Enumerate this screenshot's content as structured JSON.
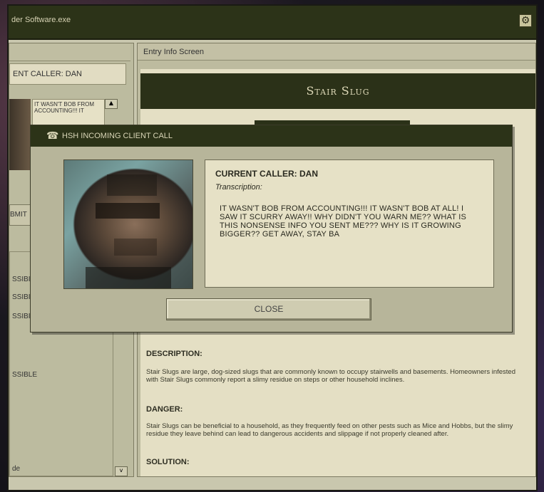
{
  "window": {
    "title": "der Software.exe",
    "icon": "gear-icon"
  },
  "left_panel": {
    "current_caller": "ENT CALLER: DAN",
    "mini_transcript": "IT WASN'T BOB FROM ACCOUNTING!!! IT",
    "submit_label": "BMIT",
    "possible_items": [
      "SSIBI",
      "SSIBI",
      "SSIBI",
      "SSIBLE"
    ],
    "bottom_text": "de",
    "scroll_down": "v"
  },
  "entry": {
    "header": "Entry Info Screen",
    "title": "Stair Slug",
    "sections": [
      {
        "heading": "DESCRIPTION:",
        "text": "Stair Slugs are large, dog-sized slugs that are commonly known to occupy stairwells and basements. Homeowners infested with Stair Slugs commonly report a slimy residue on steps or other household inclines."
      },
      {
        "heading": "DANGER:",
        "text": "Stair Slugs can be beneficial to a household, as they frequently feed on other pests such as Mice and Hobbs, but the slimy residue they leave behind can lead to dangerous accidents and slippage if not properly cleaned after."
      },
      {
        "heading": "SOLUTION:",
        "text": ""
      }
    ]
  },
  "dialog": {
    "title": "HSH INCOMING CLIENT CALL",
    "icon": "phone-icon",
    "caller_label": "CURRENT CALLER: DAN",
    "transcription_label": "Transcription:",
    "transcription": "IT WASN'T BOB FROM ACCOUNTING!!! IT WASN'T BOB AT ALL! I SAW IT SCURRY AWAY!! WHY DIDN'T YOU WARN ME?? WHAT IS THIS NONSENSE INFO YOU SENT ME??? WHY IS IT GROWING BIGGER?? GET AWAY, STAY BA",
    "close_label": "CLOSE"
  }
}
